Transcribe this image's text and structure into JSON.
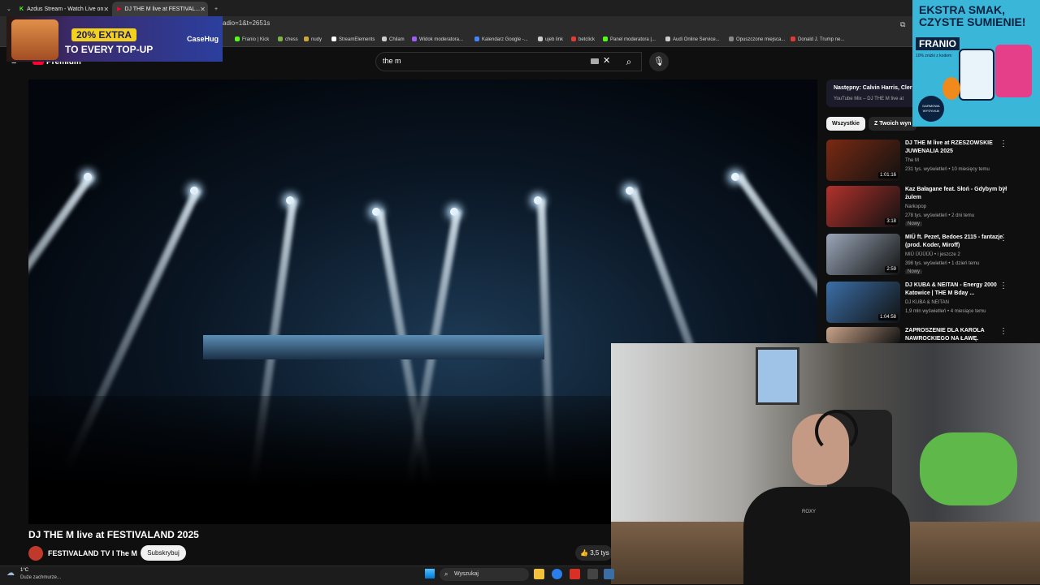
{
  "browser": {
    "tabs": [
      {
        "title": "Azdus Stream - Watch Live on"
      },
      {
        "title": "DJ THE M live at FESTIVAL..."
      }
    ],
    "url_fragment": "rt_radio=1&t=2651s",
    "bookmarks": [
      "Franio | Kick",
      "chess",
      "nudy",
      "StreamElements",
      "Chilam",
      "Widok moderatora...",
      "Kalendarz Google -...",
      "ujeb link",
      "betclick",
      "Panel moderatora |...",
      "Audi Online Service...",
      "Opuszczone miejsca...",
      "Donald J. Trump ne..."
    ],
    "bookmark_colors": [
      "#53fc18",
      "#7cb342",
      "#cfa53a",
      "#ffffff",
      "#cccccc",
      "#a259ff",
      "#4285f4",
      "#cccccc",
      "#e53935",
      "#53fc18",
      "#cccccc",
      "#888888",
      "#e53935"
    ]
  },
  "youtube": {
    "logo_suffix": "Premium",
    "search_query": "the m",
    "video": {
      "title": "DJ THE M live at FESTIVALAND 2025",
      "channel": "FESTIVALAND TV I The M",
      "subscribe_label": "Subskrybuj",
      "likes": "3,5 tys"
    },
    "up_next": {
      "label": "Następny: Calvin Harris, Cler",
      "sub": "YouTube Mix – DJ THE M live at"
    },
    "chips": [
      "Wszystkie",
      "Z Twoich wyn"
    ],
    "recommendations": [
      {
        "title": "DJ THE M live at RZESZOWSKIE JUWENALIA 2025",
        "channel": "The M",
        "meta": "231 tys. wyświetleń • 10 miesięcy temu",
        "duration": "1:01:16",
        "badge": "",
        "thumb_color": "#7a2a12"
      },
      {
        "title": "Kaz Bałagane feat. Słoń - Gdybym był żulem",
        "channel": "Narkopop",
        "meta": "278 tys. wyświetleń • 2 dni temu",
        "duration": "3:18",
        "badge": "Nowy",
        "thumb_color": "#b2322c"
      },
      {
        "title": "MIÜ ft. Pezet, Bedoes 2115 - fantazje (prod. Koder, Miroff)",
        "channel": "MIÜ ÜÜÜÜÜ • i jeszcze 2",
        "meta": "398 tys. wyświetleń • 1 dzień temu",
        "duration": "2:59",
        "badge": "Nowy",
        "thumb_color": "#9aa6b8"
      },
      {
        "title": "DJ KUBA & NEITAN - Energy 2000 Katowice | THE M Bday ...",
        "channel": "DJ KUBA & NEITAN",
        "meta": "1,9 mln wyświetleń • 4 miesiące temu",
        "duration": "1:04:58",
        "badge": "",
        "thumb_color": "#3b6fa8"
      },
      {
        "title": "ZAPROSZENIE DLA KAROLA NAWROCKIEGO NA ŁAWĘ.",
        "channel": "",
        "meta": "",
        "duration": "",
        "badge": "",
        "thumb_color": "#c9a48a"
      }
    ]
  },
  "ads": {
    "top_left": {
      "badge": "20% EXTRA",
      "line": "TO EVERY TOP-UP",
      "brand": "CaseHug"
    },
    "top_right": {
      "headline": "EKSTRA SMAK, CZYSTE SUMIENIE!",
      "brand": "FRANIO",
      "note": "10% zniżki z kodem",
      "badge": "DARMOWA WYSYŁKA!"
    }
  },
  "webcam": {
    "hoodie_text": "ROXY"
  },
  "taskbar": {
    "weather_temp": "1°C",
    "weather_desc": "Duże zachmurze...",
    "search_label": "Wyszukaj"
  },
  "icons": [
    "youtube-logo-icon",
    "search-icon",
    "clear-icon",
    "microphone-icon",
    "like-icon",
    "more-icon",
    "windows-icon",
    "folder-icon"
  ]
}
